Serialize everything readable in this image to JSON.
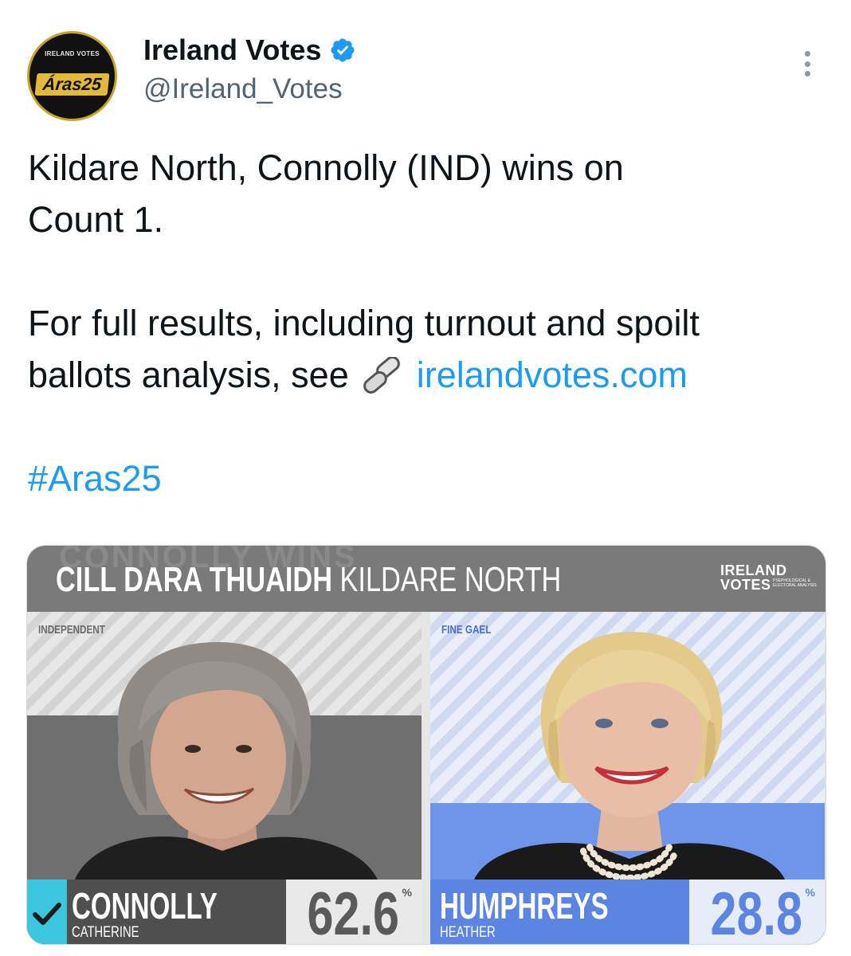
{
  "author": {
    "display_name": "Ireland Votes",
    "handle": "@Ireland_Votes",
    "avatar_top_text": "IRELAND VOTES",
    "avatar_main_text": "Áras25",
    "verified": true
  },
  "tweet": {
    "line1": "Kildare North, Connolly (IND) wins on",
    "line2": "Count 1.",
    "line3": "For full results, including turnout and spoilt",
    "line4_prefix": "ballots analysis, see",
    "link_text": "irelandvotes.com",
    "hashtag": "#Aras25"
  },
  "card": {
    "title_irish": "CILL DARA THUAIDH",
    "title_english": "KILDARE NORTH",
    "ghost_text": "CONNOLLY WINS",
    "logo_line1": "IRELAND",
    "logo_line2": "VOTES",
    "logo_small": "PSEPHOLOGICAL & ELECTORAL ANALYSIS",
    "candidates": [
      {
        "party": "INDEPENDENT",
        "surname": "CONNOLLY",
        "first_name": "CATHERINE",
        "percent": "62.6",
        "percent_sign": "%",
        "winner": true,
        "color": "#4f4f4f"
      },
      {
        "party": "FINE GAEL",
        "surname": "HUMPHREYS",
        "first_name": "HEATHER",
        "percent": "28.8",
        "percent_sign": "%",
        "winner": false,
        "color": "#5b85e0"
      }
    ]
  },
  "colors": {
    "link": "#1d9bf0",
    "verified": "#1d9bf0",
    "winner_check": "#3cc6de"
  }
}
